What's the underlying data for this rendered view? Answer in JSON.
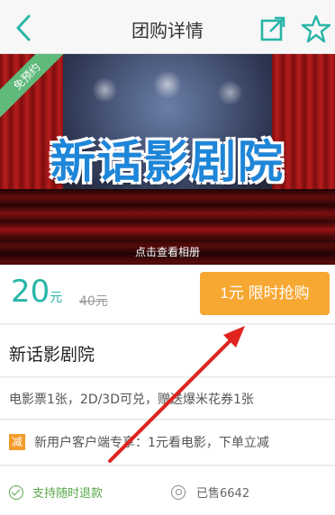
{
  "header": {
    "title": "团购详情",
    "back_icon": "chevron-left-icon",
    "share_icon": "share-external-icon",
    "fav_icon": "star-outline-icon",
    "accent": "#28b5a7"
  },
  "banner": {
    "ribbon": "免预约",
    "title": "新话影剧院",
    "caption": "点击查看相册"
  },
  "price": {
    "current": "20",
    "unit": "元",
    "original": "40元",
    "button": "1元  限时抢购",
    "button_color": "#f6a833"
  },
  "deal": {
    "name": "新话影剧院",
    "description": "电影票1张，2D/3D可兑，赠送爆米花券1张",
    "promo_badge": "减",
    "promo_text": "新用户客户端专享：1元看电影，下单立减"
  },
  "meta": {
    "refund": "支持随时退款",
    "sold": "已售6642"
  }
}
